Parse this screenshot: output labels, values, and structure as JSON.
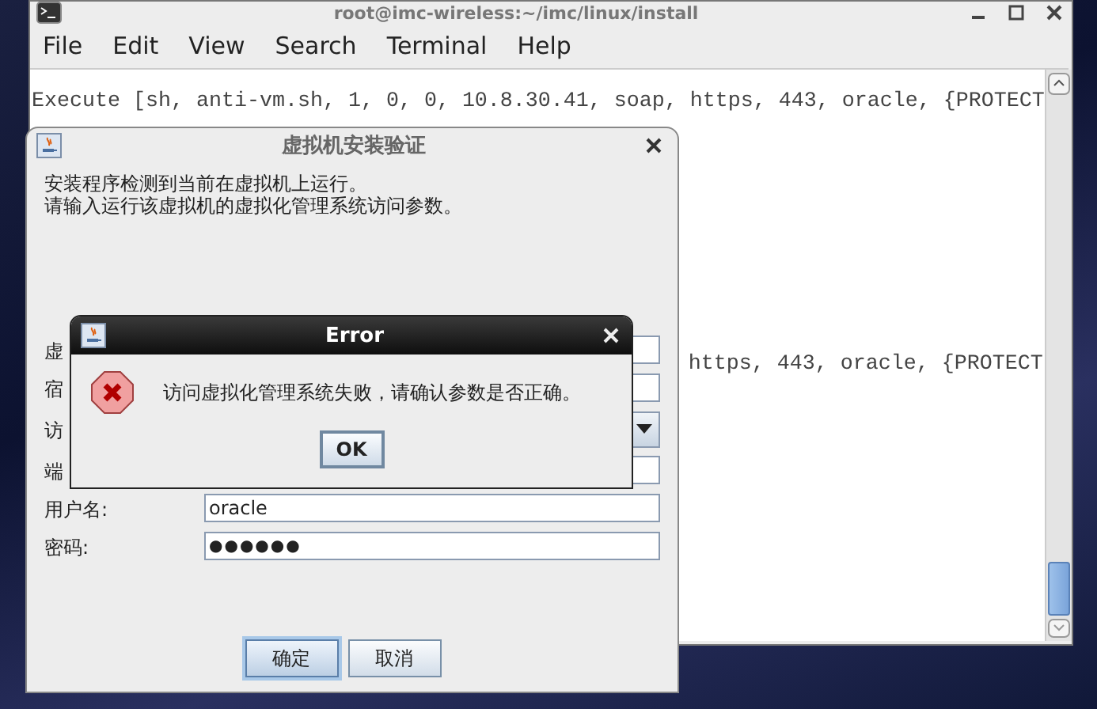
{
  "terminal": {
    "title": "root@imc-wireless:~/imc/linux/install",
    "menu": [
      "File",
      "Edit",
      "View",
      "Search",
      "Terminal",
      "Help"
    ],
    "lines": [
      {
        "kind": "full",
        "text": "Execute [sh, anti-vm.sh, 1, 0, 0, 10.8.30.41, soap, https, 443, oracle, {PROTECT"
      },
      {
        "kind": "partial",
        "text": "https, 443, oracle, {PROTECT"
      }
    ]
  },
  "install_dialog": {
    "title": "虚拟机安装验证",
    "message_lines": [
      "安装程序检测到当前在虚拟机上运行。",
      "请输入运行该虚拟机的虚拟化管理系统访问参数。"
    ],
    "fields": [
      {
        "kind": "text",
        "label": "虚"
      },
      {
        "kind": "text",
        "label": "宿"
      },
      {
        "kind": "combo",
        "label": "访"
      },
      {
        "kind": "text",
        "label": "端"
      },
      {
        "kind": "text",
        "label": "用户名:",
        "value": "oracle"
      },
      {
        "kind": "password",
        "label": "密码:",
        "value": "●●●●●●"
      }
    ],
    "buttons": [
      {
        "label": "确定",
        "selected": true
      },
      {
        "label": "取消",
        "selected": false
      }
    ]
  },
  "error_dialog": {
    "title": "Error",
    "message": "访问虚拟化管理系统失败，请确认参数是否正确。",
    "button": "OK"
  }
}
